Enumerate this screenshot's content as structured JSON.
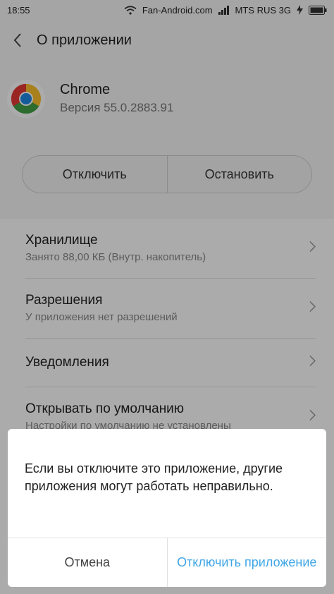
{
  "status_bar": {
    "time": "18:55",
    "site": "Fan-Android.com",
    "carrier": "MTS RUS 3G",
    "icons": [
      "wifi-icon",
      "signal-icon",
      "charging-icon",
      "battery-icon"
    ]
  },
  "header": {
    "back_icon": "back-arrow-icon",
    "title": "О приложении"
  },
  "app": {
    "icon": "chrome-logo-icon",
    "name": "Chrome",
    "version": "Версия 55.0.2883.91"
  },
  "actions": {
    "disable_label": "Отключить",
    "stop_label": "Остановить"
  },
  "settings": {
    "items": [
      {
        "title": "Хранилище",
        "subtitle": "Занято 88,00 КБ (Внутр. накопитель)"
      },
      {
        "title": "Разрешения",
        "subtitle": "У приложения нет разрешений"
      },
      {
        "title": "Уведомления",
        "subtitle": ""
      },
      {
        "title": "Открывать по умолчанию",
        "subtitle": "Настройки по умолчанию не установлены"
      }
    ]
  },
  "dialog": {
    "message": "Если вы отключите это приложение, другие приложения могут работать неправильно.",
    "cancel_label": "Отмена",
    "confirm_label": "Отключить приложение"
  },
  "colors": {
    "accent": "#3fa6e6",
    "overlay": "rgba(0,0,0,0.33)"
  }
}
